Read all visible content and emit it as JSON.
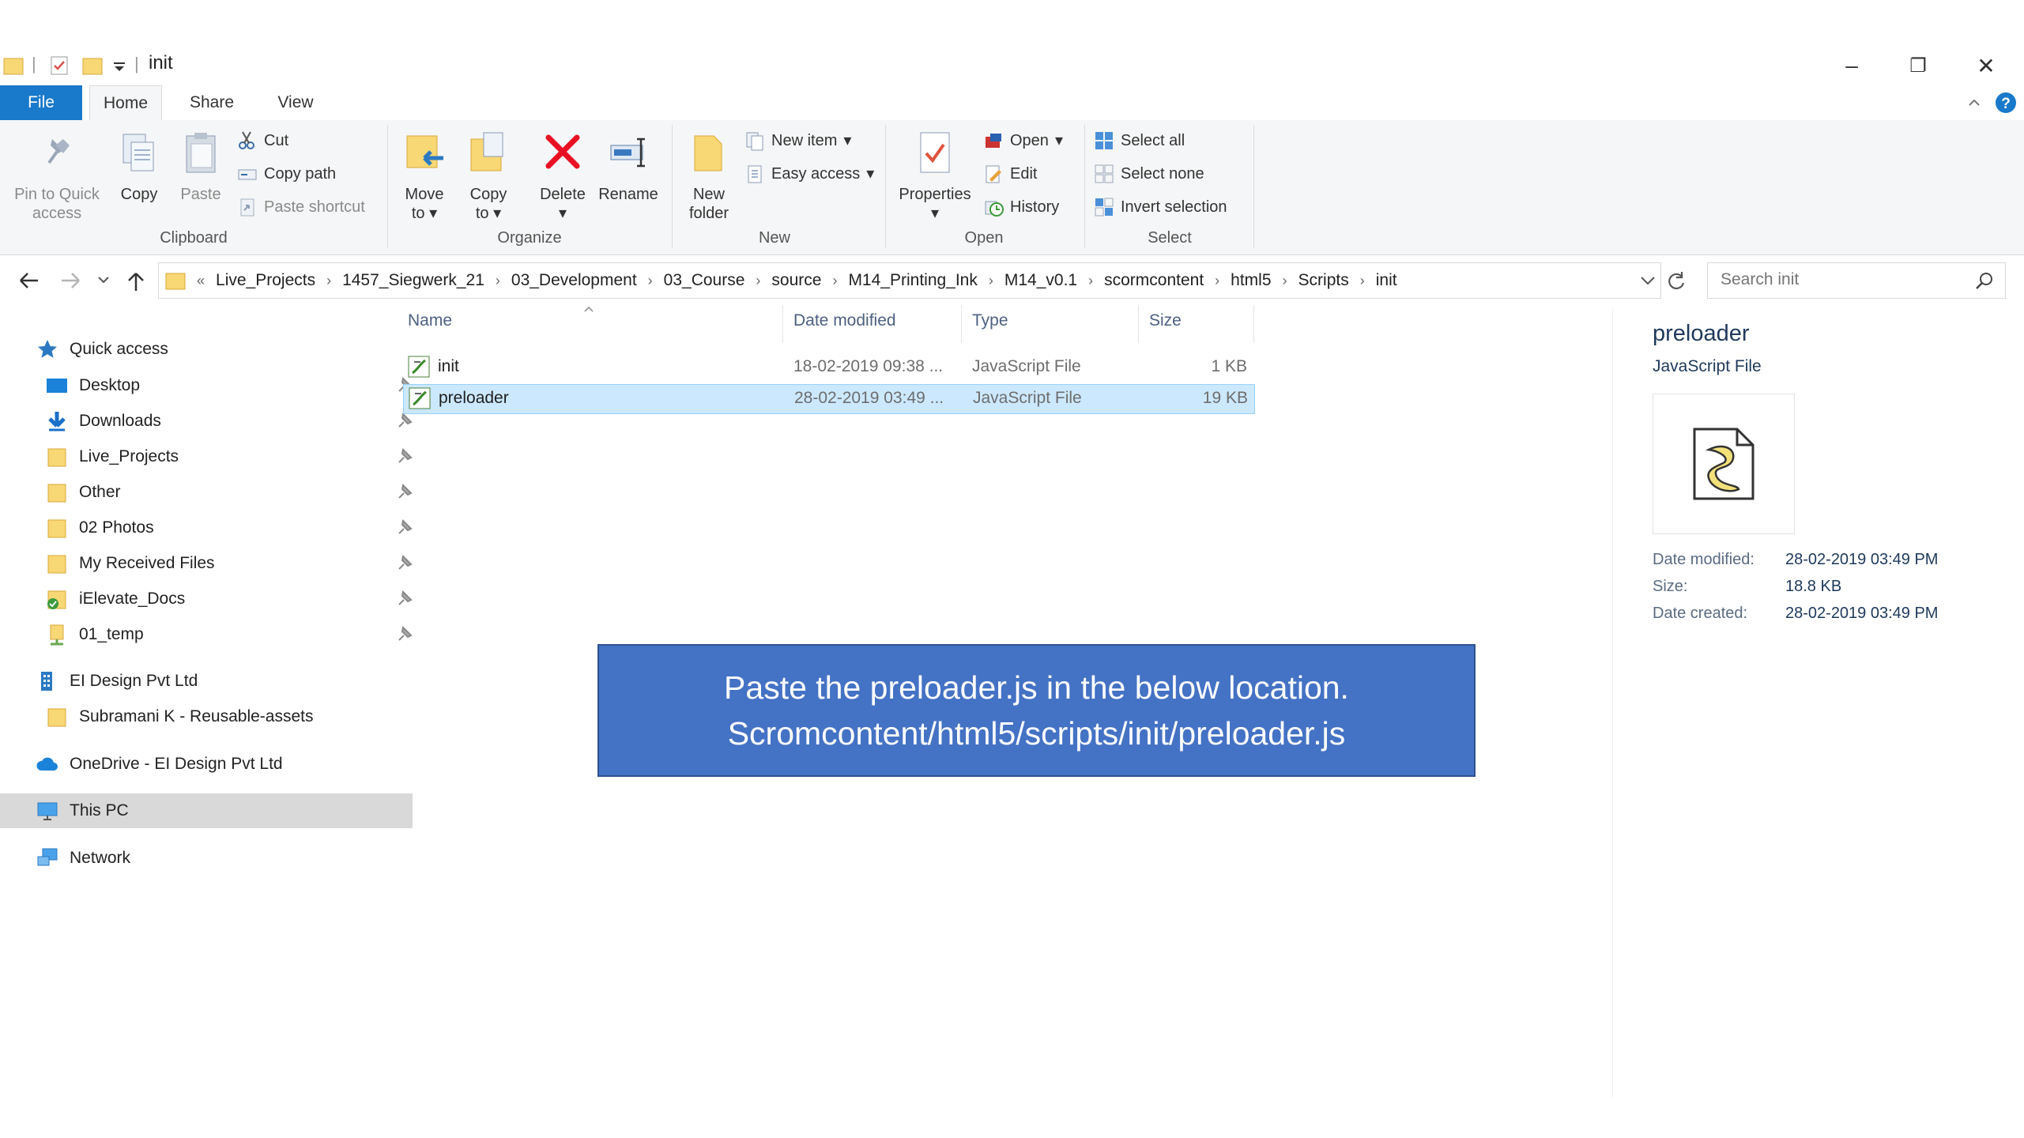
{
  "window": {
    "title": "init"
  },
  "window_controls": {
    "minimize": "–",
    "restore": "❐",
    "close": "✕"
  },
  "tabs": [
    {
      "label": "File"
    },
    {
      "label": "Home"
    },
    {
      "label": "Share"
    },
    {
      "label": "View"
    }
  ],
  "ribbon": {
    "clipboard": {
      "group_label": "Clipboard",
      "pin_label_1": "Pin to Quick",
      "pin_label_2": "access",
      "copy": "Copy",
      "paste": "Paste",
      "cut": "Cut",
      "copy_path": "Copy path",
      "paste_shortcut": "Paste shortcut"
    },
    "organize": {
      "group_label": "Organize",
      "move_1": "Move",
      "move_2": "to",
      "copy_1": "Copy",
      "copy_2": "to",
      "delete": "Delete",
      "rename": "Rename"
    },
    "new": {
      "group_label": "New",
      "new_folder_1": "New",
      "new_folder_2": "folder",
      "new_item": "New item",
      "easy_access": "Easy access"
    },
    "open": {
      "group_label": "Open",
      "properties": "Properties",
      "open": "Open",
      "edit": "Edit",
      "history": "History"
    },
    "select": {
      "group_label": "Select",
      "select_all": "Select all",
      "select_none": "Select none",
      "invert_selection": "Invert selection"
    }
  },
  "address": {
    "crumbs": [
      "Live_Projects",
      "1457_Siegwerk_21",
      "03_Development",
      "03_Course",
      "source",
      "M14_Printing_Ink",
      "M14_v0.1",
      "scormcontent",
      "html5",
      "Scripts",
      "init"
    ],
    "overflow": "«"
  },
  "search": {
    "placeholder": "Search init"
  },
  "nav": {
    "quick_access": "Quick access",
    "items": [
      {
        "label": "Desktop"
      },
      {
        "label": "Downloads"
      },
      {
        "label": "Live_Projects"
      },
      {
        "label": "Other"
      },
      {
        "label": "02 Photos"
      },
      {
        "label": "My Received Files"
      },
      {
        "label": "iElevate_Docs"
      },
      {
        "label": "01_temp"
      }
    ],
    "org": "EI Design Pvt Ltd",
    "org_child": "Subramani K - Reusable-assets",
    "onedrive": "OneDrive - EI Design Pvt Ltd",
    "this_pc": "This PC",
    "network": "Network"
  },
  "list": {
    "columns": {
      "name": "Name",
      "date": "Date modified",
      "type": "Type",
      "size": "Size"
    },
    "rows": [
      {
        "name": "init",
        "date": "18-02-2019 09:38 ...",
        "type": "JavaScript File",
        "size": "1 KB"
      },
      {
        "name": "preloader",
        "date": "28-02-2019 03:49 ...",
        "type": "JavaScript File",
        "size": "19 KB"
      }
    ]
  },
  "details": {
    "title": "preloader",
    "type": "JavaScript File",
    "props": [
      {
        "label": "Date modified:",
        "value": "28-02-2019 03:49 PM"
      },
      {
        "label": "Size:",
        "value": "18.8 KB"
      },
      {
        "label": "Date created:",
        "value": "28-02-2019 03:49 PM"
      }
    ]
  },
  "callout": {
    "line1": "Paste the preloader.js in the below location.",
    "line2": "Scromcontent/html5/scripts/init/preloader.js"
  },
  "colors": {
    "accent": "#1979ca",
    "selection": "#cce8ff",
    "callout": "#4472c4"
  }
}
